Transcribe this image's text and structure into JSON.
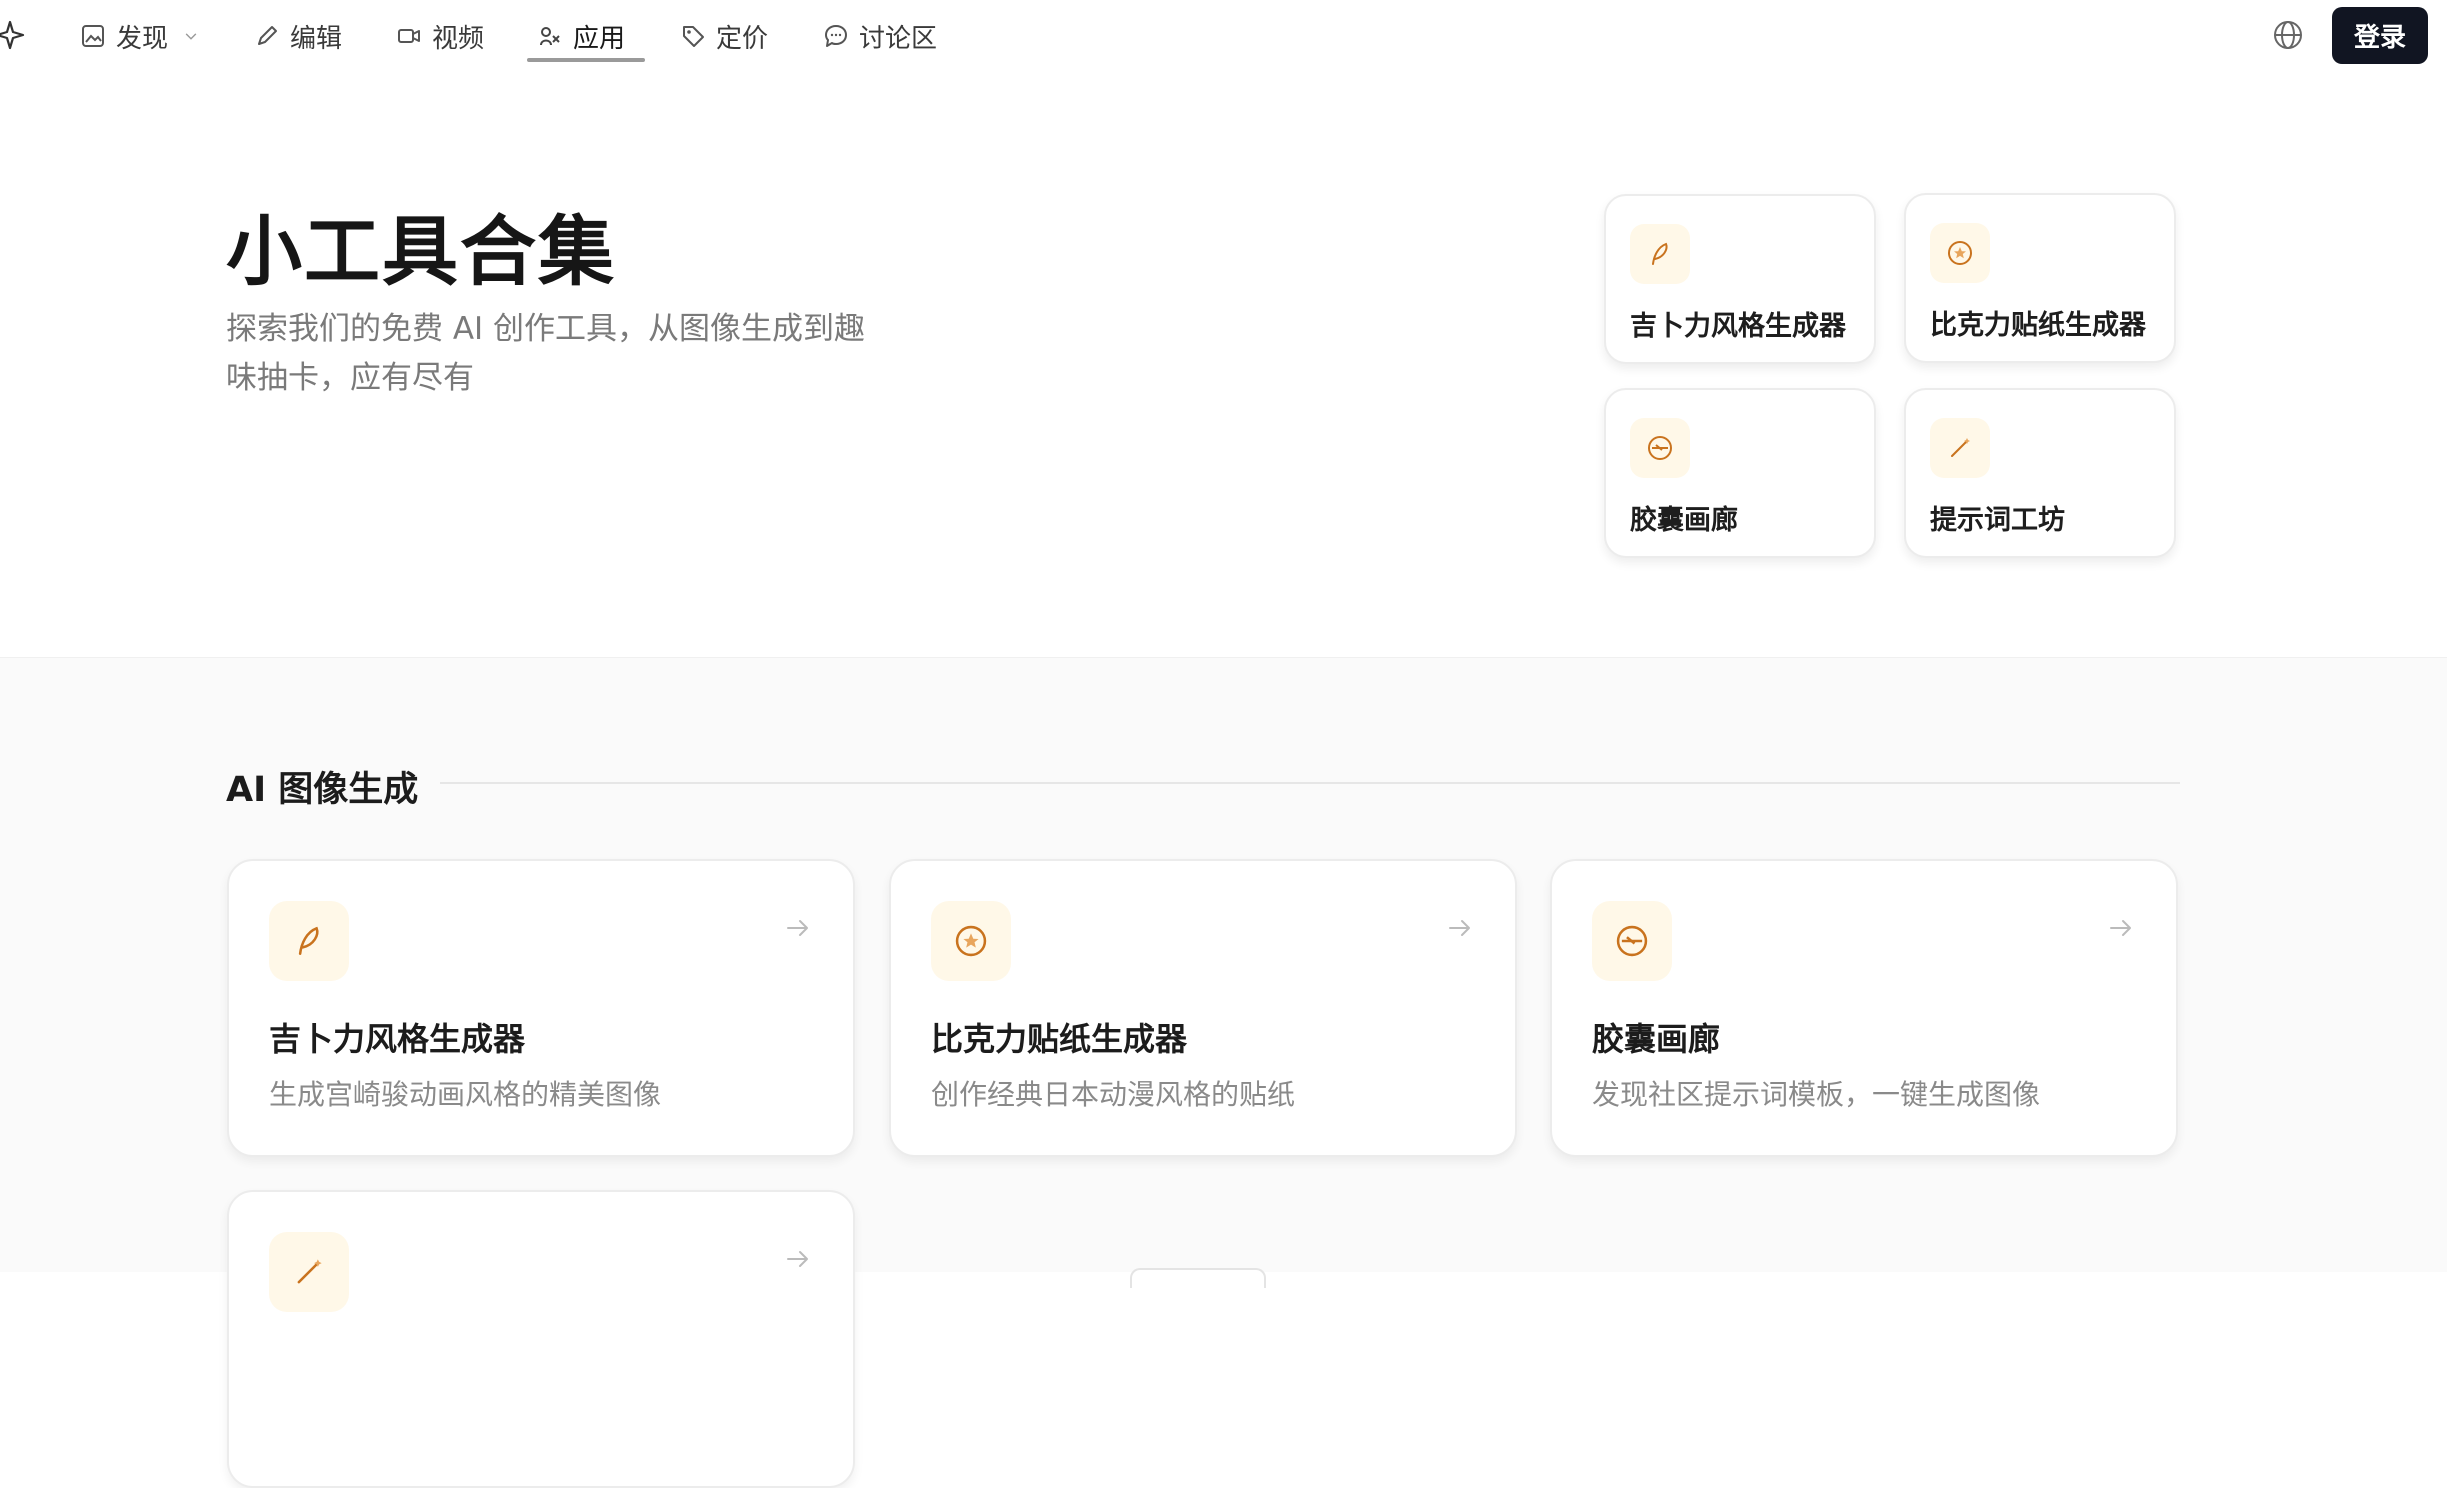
{
  "nav": {
    "items": [
      {
        "label": "发现",
        "icon": "image-icon"
      },
      {
        "label": "编辑",
        "icon": "pencil-icon"
      },
      {
        "label": "视频",
        "icon": "video-icon"
      },
      {
        "label": "应用",
        "icon": "apps-icon",
        "active": true
      },
      {
        "label": "定价",
        "icon": "tag-icon"
      },
      {
        "label": "讨论区",
        "icon": "chat-icon"
      }
    ],
    "login_label": "登录",
    "logo_icon": "sparkle-icon",
    "language_icon": "globe-icon"
  },
  "hero": {
    "title": "小工具合集",
    "description": "探索我们的免费 AI 创作工具，从图像生成到趣味抽卡，应有尽有",
    "quick_tools": [
      {
        "label": "吉卜力风格生成器",
        "icon": "feather-icon"
      },
      {
        "label": "比克力贴纸生成器",
        "icon": "star-badge-icon"
      },
      {
        "label": "胶囊画廊",
        "icon": "capsule-icon"
      },
      {
        "label": "提示词工坊",
        "icon": "wand-icon"
      }
    ]
  },
  "section": {
    "title": "AI 图像生成",
    "tools": [
      {
        "title": "吉卜力风格生成器",
        "desc": "生成宫崎骏动画风格的精美图像",
        "icon": "feather-icon"
      },
      {
        "title": "比克力贴纸生成器",
        "desc": "创作经典日本动漫风格的贴纸",
        "icon": "star-badge-icon"
      },
      {
        "title": "胶囊画廊",
        "desc": "发现社区提示词模板，一键生成图像",
        "icon": "capsule-icon"
      },
      {
        "title": "",
        "desc": "",
        "icon": "wand-icon"
      }
    ]
  },
  "colors": {
    "accent": "#c9731e",
    "icon_bg": "#fff8e8",
    "login_bg": "#111522"
  }
}
